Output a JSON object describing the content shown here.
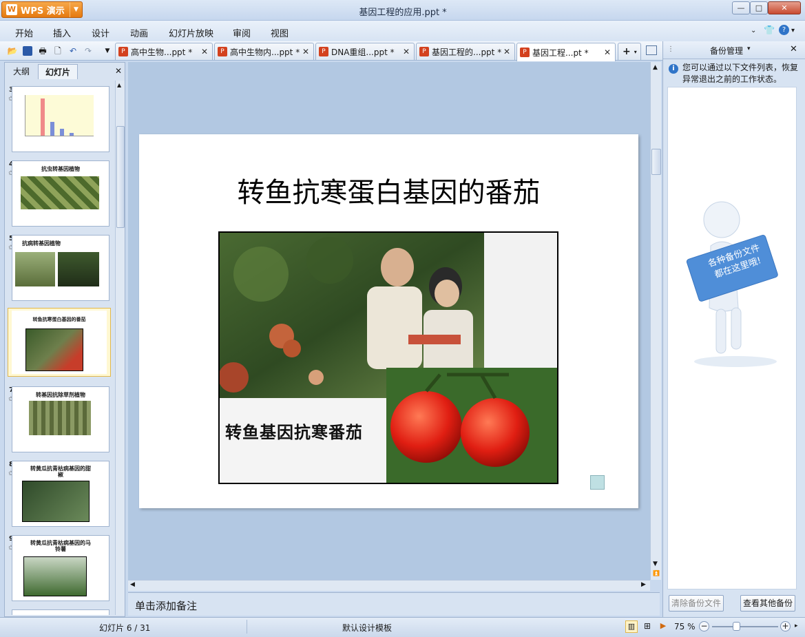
{
  "app": {
    "name": "WPS 演示",
    "window_title": "基因工程的应用.ppt *"
  },
  "menu": [
    "开始",
    "插入",
    "设计",
    "动画",
    "幻灯片放映",
    "审阅",
    "视图"
  ],
  "tabs": [
    {
      "label": "高中生物...ppt *"
    },
    {
      "label": "高中生物内...ppt *"
    },
    {
      "label": "DNA重组...ppt *"
    },
    {
      "label": "基因工程的...ppt *"
    },
    {
      "label": "基因工程...pt *"
    }
  ],
  "left_panel": {
    "tabs": [
      "大纲",
      "幻灯片"
    ],
    "slides": [
      {
        "num": "3",
        "title": ""
      },
      {
        "num": "4",
        "title": "抗虫转基因植物"
      },
      {
        "num": "5",
        "title": "抗病转基因植物"
      },
      {
        "num": "6",
        "title": "转鱼抗寒蛋白基因的番茄"
      },
      {
        "num": "7",
        "title": "转基因抗除草剂植物"
      },
      {
        "num": "8",
        "title": "转黄瓜抗青枯病基因的甜椒"
      },
      {
        "num": "9",
        "title": "转黄瓜抗青枯病基因的马铃薯"
      }
    ]
  },
  "slide": {
    "title": "转鱼抗寒蛋白基因的番茄",
    "image_caption": "转鱼基因抗寒番茄"
  },
  "notes_placeholder": "单击添加备注",
  "right_panel": {
    "title": "备份管理",
    "info": "您可以通过以下文件列表，恢复异常退出之前的工作状态。",
    "sign_line1": "各种备份文件",
    "sign_line2": "都在这里哦!",
    "btn_clear": "清除备份文件",
    "btn_view_other": "查看其他备份"
  },
  "status": {
    "slide_counter": "幻灯片 6 / 31",
    "template": "默认设计模板",
    "zoom": "75 %"
  }
}
